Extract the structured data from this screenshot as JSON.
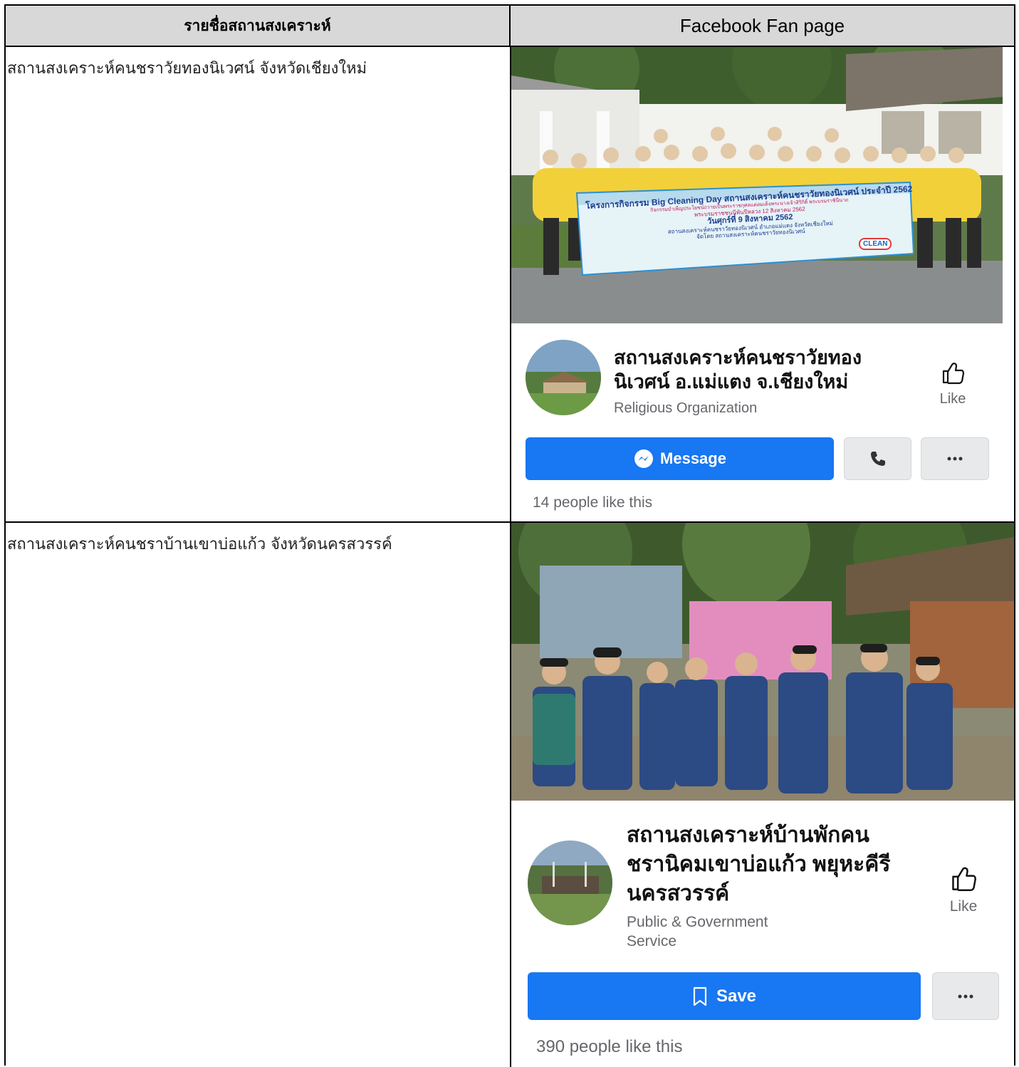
{
  "table": {
    "header_left": "รายชื่อสถานสงเคราะห์",
    "header_right": "Facebook Fan page"
  },
  "rows": [
    {
      "name": "สถานสงเคราะห์คนชราวัยทองนิเวศน์ จังหวัดเชียงใหม่",
      "banner": {
        "line1": "โครงการกิจกรรม Big Cleaning Day สถานสงเคราะห์คนชราวัยทองนิเวศน์ ประจำปี 2562",
        "line2": "กิจกรรมบำเพ็ญประโยชน์ถวายเป็นพระราชกุศลแด่สมเด็จพระนางเจ้าสิริกิติ์ พระบรมราชินีนาถ",
        "line3": "พระบรมราชชนนีพันปีหลวง 12 สิงหาคม 2562",
        "line4": "วันศุกร์ที่ 9 สิงหาคม 2562",
        "line5": "สถานสงเคราะห์คนชราวัยทองนิเวศน์ อำเภอแม่แตง จังหวัดเชียงใหม่",
        "line6": "จัดโดย สถานสงเคราะห์คนชราวัยทองนิเวศน์",
        "badge": "CLEAN"
      },
      "page_title_1": "สถานสงเคราะห์คนชราวัยทอง",
      "page_title_2": "นิเวศน์ อ.แม่แตง จ.เชียงใหม่",
      "category": "Religious Organization",
      "like_label": "Like",
      "primary_button": "Message",
      "likes_text": "14 people like this"
    },
    {
      "name": "สถานสงเคราะห์คนชราบ้านเขาบ่อแก้ว จังหวัดนครสวรรค์",
      "page_title_1": "สถานสงเคราะห์บ้านพักคน",
      "page_title_2": "ชรานิคมเขาบ่อแก้ว พยุหะคีรี",
      "page_title_3": "นครสวรรค์",
      "category_1": "Public & Government",
      "category_2": "Service",
      "like_label": "Like",
      "primary_button": "Save",
      "likes_text": "390 people like this"
    }
  ],
  "icons": {
    "like": "thumbs-up-icon",
    "messenger": "messenger-icon",
    "phone": "phone-icon",
    "more": "more-icon",
    "bookmark": "bookmark-icon"
  },
  "colors": {
    "facebook_blue": "#1877f2",
    "header_grey": "#d8d8d8"
  }
}
